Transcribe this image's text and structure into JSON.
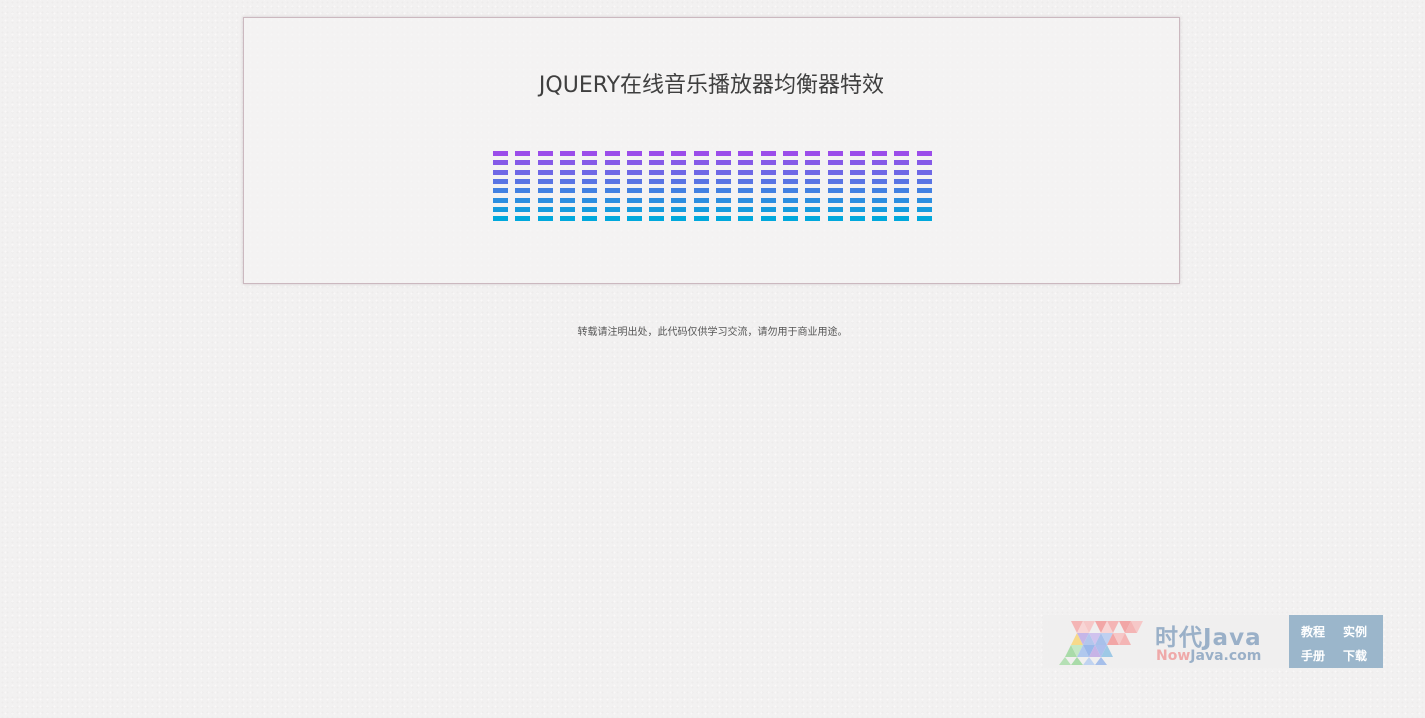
{
  "page": {
    "title": "JQUERY在线音乐播放器均衡器特效",
    "notice": "转载请注明出处，此代码仅供学习交流，请勿用于商业用途。"
  },
  "equalizer": {
    "columns": 20,
    "segments_per_column": 8,
    "gradient_top": "#9b4dea",
    "gradient_bottom": "#00a8dc",
    "levels": [
      1,
      1,
      1,
      1,
      1,
      1,
      1,
      1,
      1,
      1,
      1,
      1,
      1,
      1,
      1,
      1,
      1,
      1,
      1,
      1
    ]
  },
  "logo": {
    "brand": "时代Java",
    "domain_prefix": "Now",
    "domain_suffix": "Java.com",
    "links": [
      "教程",
      "实例",
      "手册",
      "下载"
    ],
    "colors": {
      "blue": "#9bb6cb",
      "pink": "#efa9a9"
    }
  }
}
